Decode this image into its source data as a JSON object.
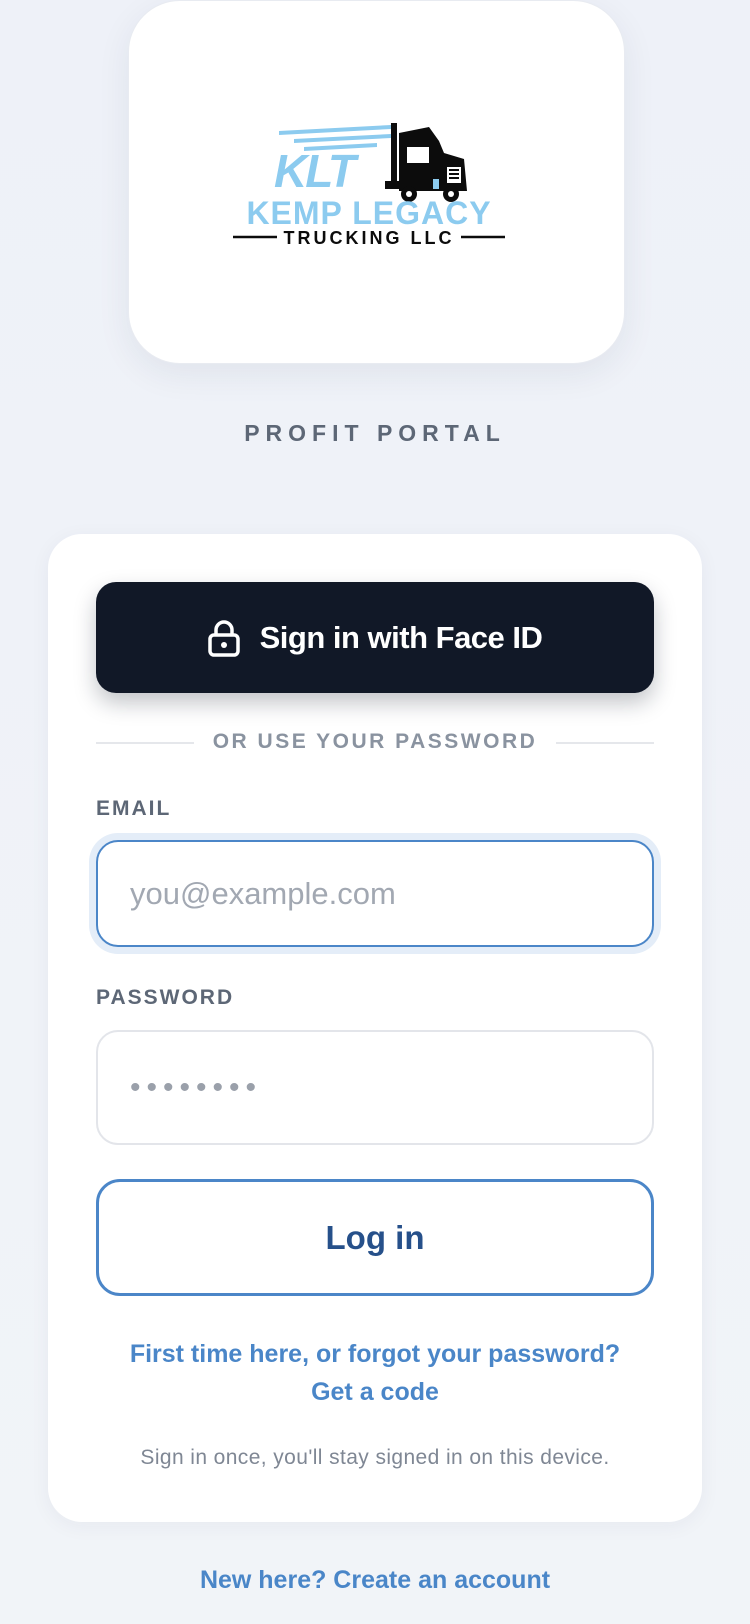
{
  "brand": {
    "logo_monogram": "KLT",
    "logo_name": "KEMP LEGACY",
    "logo_tagline": "TRUCKING LLC",
    "logo_blue": "#8ccbef",
    "logo_dark": "#0c0c0c"
  },
  "portal_label": "PROFIT PORTAL",
  "faceid": {
    "label": "Sign in with Face ID",
    "icon": "lock-icon"
  },
  "divider_text": "OR USE YOUR PASSWORD",
  "email": {
    "label": "EMAIL",
    "placeholder": "you@example.com",
    "value": ""
  },
  "password": {
    "label": "PASSWORD",
    "masked_value": "••••••••"
  },
  "login_button": "Log in",
  "reset_link": {
    "line1": "First time here, or forgot your password?",
    "line2": "Get a code"
  },
  "helper_text": "Sign in once, you'll stay signed in on this device.",
  "create_account_link": "New here? Create an account",
  "colors": {
    "accent": "#4a86c8",
    "dark_button": "#111827",
    "login_text": "#26508a",
    "muted_text": "#5d6776"
  }
}
